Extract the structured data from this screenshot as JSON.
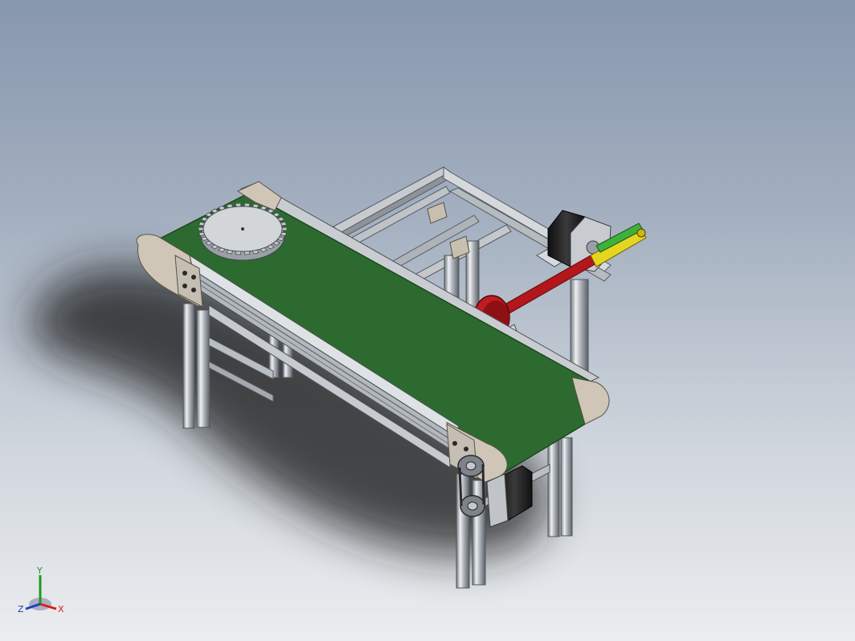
{
  "colors": {
    "background_top": "#8797ad",
    "background_bottom": "#ebedef",
    "belt": "#2c6a2f",
    "profile_light": "#e6e8ea",
    "profile_mid": "#a9aeb4",
    "profile_dark": "#5f656c",
    "end_cap": "#cfc6b8",
    "gear": "#d3d6d9",
    "motor_black": "#1d1d1d",
    "disc_red": "#b3161b",
    "link_yellow": "#e6d51f",
    "link_green": "#3fb13b",
    "triad_x": "#d9201a",
    "triad_y": "#1e9a1e",
    "triad_z": "#1f3fb8"
  },
  "icons": {
    "orientation_triad": "xyz-triad-icon"
  },
  "triad": {
    "x_label": "X",
    "y_label": "Y",
    "z_label": "Z"
  }
}
